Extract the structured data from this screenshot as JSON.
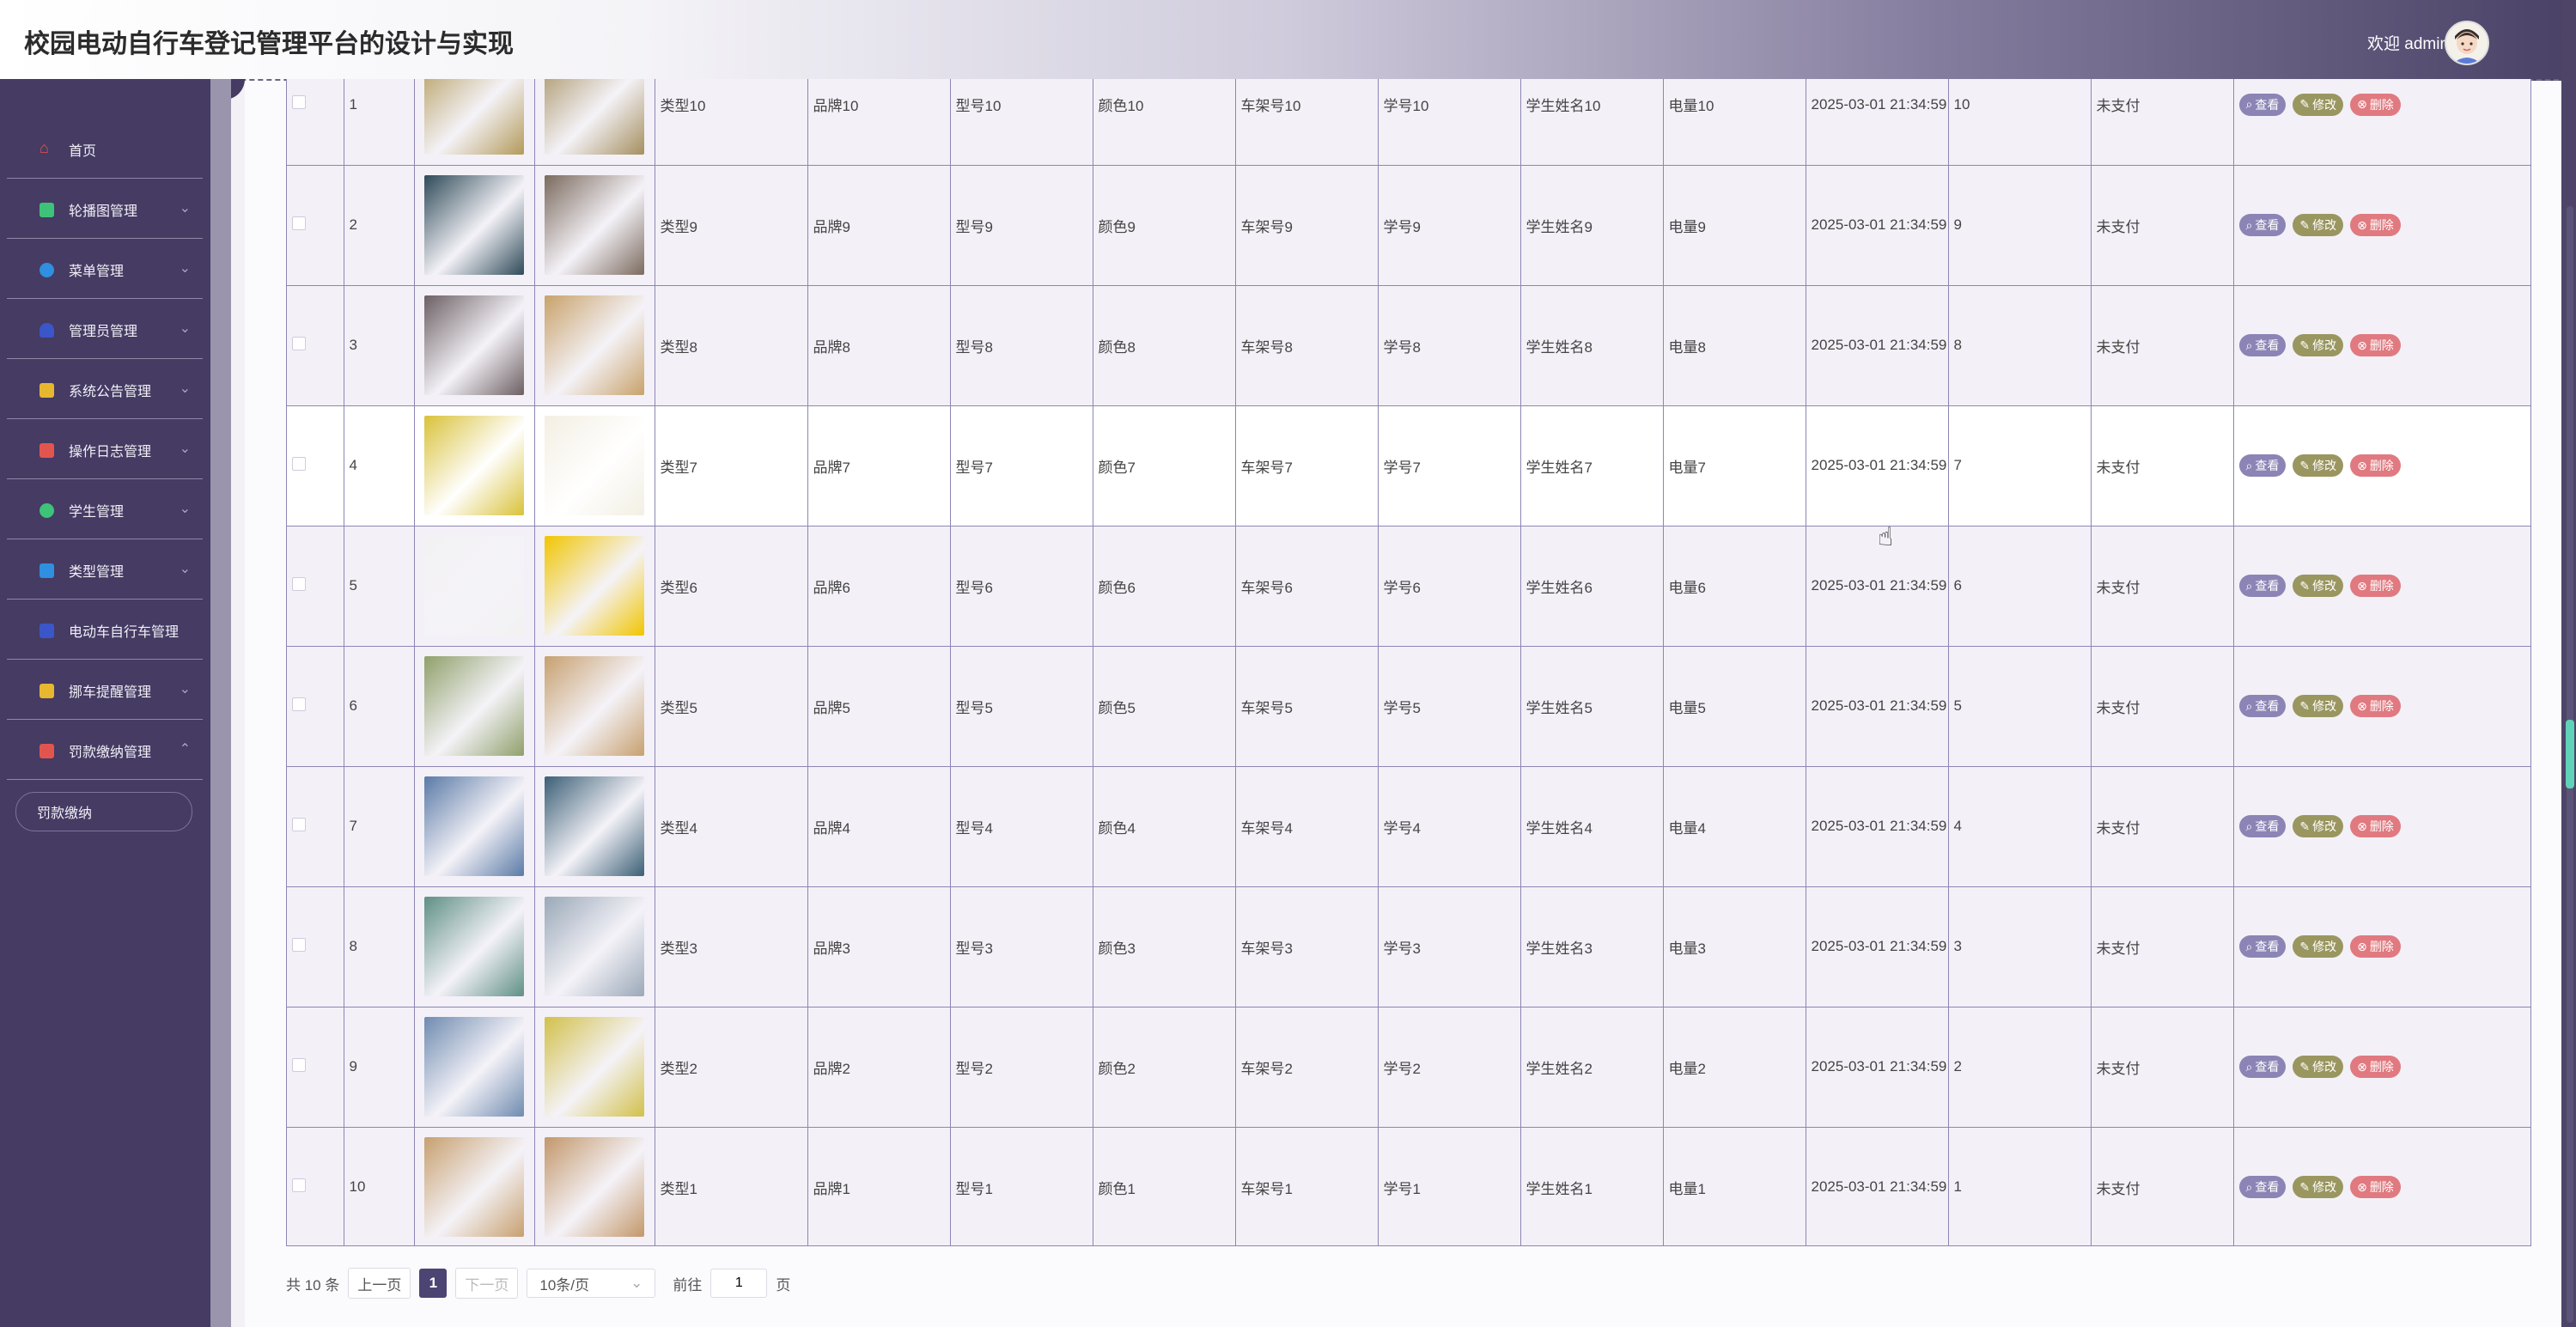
{
  "header": {
    "title": "校园电动自行车登记管理平台的设计与实现",
    "welcome": "欢迎 admin"
  },
  "sidebar": {
    "items": [
      {
        "label": "首页",
        "icon": "home-icon",
        "color": "#e2554f"
      },
      {
        "label": "轮播图管理",
        "icon": "image-icon",
        "color": "#3ec27a"
      },
      {
        "label": "菜单管理",
        "icon": "menu-icon",
        "color": "#2f8fe0"
      },
      {
        "label": "管理员管理",
        "icon": "admin-icon",
        "color": "#3a56c9"
      },
      {
        "label": "系统公告管理",
        "icon": "notice-icon",
        "color": "#e7b72f"
      },
      {
        "label": "操作日志管理",
        "icon": "log-icon",
        "color": "#e2554f"
      },
      {
        "label": "学生管理",
        "icon": "student-icon",
        "color": "#3ec27a"
      },
      {
        "label": "类型管理",
        "icon": "type-icon",
        "color": "#2f8fe0"
      },
      {
        "label": "电动车自行车管理",
        "icon": "bike-icon",
        "color": "#3a56c9"
      },
      {
        "label": "挪车提醒管理",
        "icon": "reminder-icon",
        "color": "#e7b72f"
      },
      {
        "label": "罚款缴纳管理",
        "icon": "fine-icon",
        "color": "#e2554f"
      }
    ],
    "submenu": [
      "罚款缴纳"
    ]
  },
  "table": {
    "rows": [
      {
        "no": "1",
        "type": "类型10",
        "brand": "品牌10",
        "model": "型号10",
        "color": "颜色10",
        "frame": "车架号10",
        "sid": "学号10",
        "sname": "学生姓名10",
        "battery": "电量10",
        "time": "2025-03-01 21:34:59",
        "amount": "10",
        "status": "未支付",
        "img1": "#b39a5a",
        "img2": "#a58f5f"
      },
      {
        "no": "2",
        "type": "类型9",
        "brand": "品牌9",
        "model": "型号9",
        "color": "颜色9",
        "frame": "车架号9",
        "sid": "学号9",
        "sname": "学生姓名9",
        "battery": "电量9",
        "time": "2025-03-01 21:34:59",
        "amount": "9",
        "status": "未支付",
        "img1": "#2e4a58",
        "img2": "#7b6a5e"
      },
      {
        "no": "3",
        "type": "类型8",
        "brand": "品牌8",
        "model": "型号8",
        "color": "颜色8",
        "frame": "车架号8",
        "sid": "学号8",
        "sname": "学生姓名8",
        "battery": "电量8",
        "time": "2025-03-01 21:34:59",
        "amount": "8",
        "status": "未支付",
        "img1": "#6c5f63",
        "img2": "#c8a26a"
      },
      {
        "no": "4",
        "type": "类型7",
        "brand": "品牌7",
        "model": "型号7",
        "color": "颜色7",
        "frame": "车架号7",
        "sid": "学号7",
        "sname": "学生姓名7",
        "battery": "电量7",
        "time": "2025-03-01 21:34:59",
        "amount": "7",
        "status": "未支付",
        "img1": "#d9c23a",
        "img2": "#f3efe3"
      },
      {
        "no": "5",
        "type": "类型6",
        "brand": "品牌6",
        "model": "型号6",
        "color": "颜色6",
        "frame": "车架号6",
        "sid": "学号6",
        "sname": "学生姓名6",
        "battery": "电量6",
        "time": "2025-03-01 21:34:59",
        "amount": "6",
        "status": "未支付",
        "img1": "#f2f2f2",
        "img2": "#f1c500"
      },
      {
        "no": "6",
        "type": "类型5",
        "brand": "品牌5",
        "model": "型号5",
        "color": "颜色5",
        "frame": "车架号5",
        "sid": "学号5",
        "sname": "学生姓名5",
        "battery": "电量5",
        "time": "2025-03-01 21:34:59",
        "amount": "5",
        "status": "未支付",
        "img1": "#8fa06a",
        "img2": "#c7a06f"
      },
      {
        "no": "7",
        "type": "类型4",
        "brand": "品牌4",
        "model": "型号4",
        "color": "颜色4",
        "frame": "车架号4",
        "sid": "学号4",
        "sname": "学生姓名4",
        "battery": "电量4",
        "time": "2025-03-01 21:34:59",
        "amount": "4",
        "status": "未支付",
        "img1": "#5a7aa6",
        "img2": "#3b5f76"
      },
      {
        "no": "8",
        "type": "类型3",
        "brand": "品牌3",
        "model": "型号3",
        "color": "颜色3",
        "frame": "车架号3",
        "sid": "学号3",
        "sname": "学生姓名3",
        "battery": "电量3",
        "time": "2025-03-01 21:34:59",
        "amount": "3",
        "status": "未支付",
        "img1": "#5f8f86",
        "img2": "#9aa8b8"
      },
      {
        "no": "9",
        "type": "类型2",
        "brand": "品牌2",
        "model": "型号2",
        "color": "颜色2",
        "frame": "车架号2",
        "sid": "学号2",
        "sname": "学生姓名2",
        "battery": "电量2",
        "time": "2025-03-01 21:34:59",
        "amount": "2",
        "status": "未支付",
        "img1": "#6f8bb0",
        "img2": "#d2c04a"
      },
      {
        "no": "10",
        "type": "类型1",
        "brand": "品牌1",
        "model": "型号1",
        "color": "颜色1",
        "frame": "车架号1",
        "sid": "学号1",
        "sname": "学生姓名1",
        "battery": "电量1",
        "time": "2025-03-01 21:34:59",
        "amount": "1",
        "status": "未支付",
        "img1": "#c7a06f",
        "img2": "#c3976a"
      }
    ],
    "actions": {
      "view": "查看",
      "edit": "修改",
      "delete": "删除"
    }
  },
  "pagination": {
    "total": "共 10 条",
    "prev": "上一页",
    "current": "1",
    "next": "下一页",
    "page_size": "10条/页",
    "goto": "前往",
    "goto_value": "1",
    "page_unit": "页"
  }
}
